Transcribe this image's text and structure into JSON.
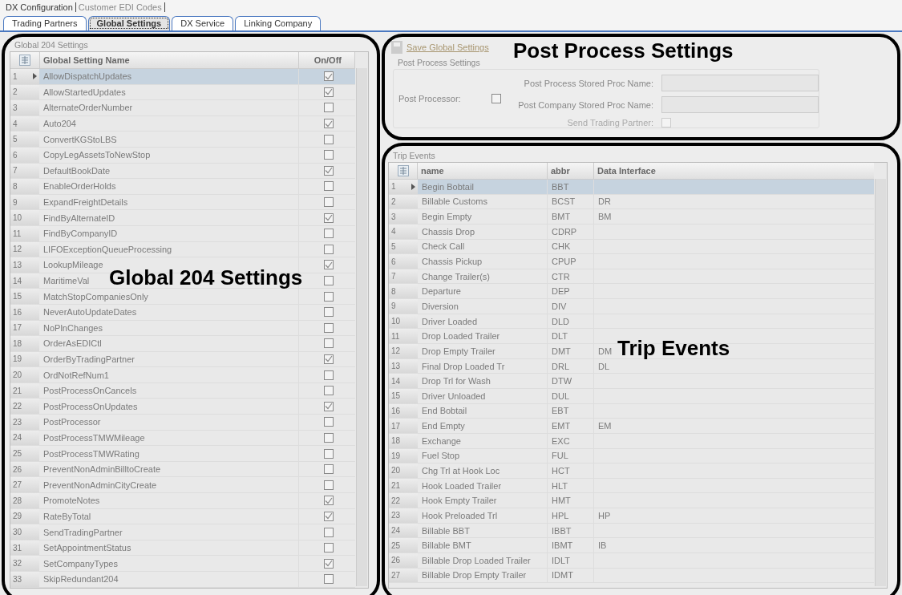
{
  "top_menu": [
    {
      "label": "DX Configuration",
      "selected": true
    },
    {
      "label": "Customer EDI Codes",
      "selected": false
    }
  ],
  "tabs": [
    {
      "label": "Trading Partners",
      "selected": false
    },
    {
      "label": "Global Settings",
      "selected": true
    },
    {
      "label": "DX Service",
      "selected": false
    },
    {
      "label": "Linking Company",
      "selected": false
    }
  ],
  "global_settings": {
    "group_title": "Global 204 Settings",
    "columns": [
      "Global Setting Name",
      "On/Off"
    ],
    "rows": [
      {
        "num": "1",
        "name": "AllowDispatchUpdates",
        "checked": true,
        "selected": true
      },
      {
        "num": "2",
        "name": "AllowStartedUpdates",
        "checked": true,
        "selected": false
      },
      {
        "num": "3",
        "name": "AlternateOrderNumber",
        "checked": false,
        "selected": false
      },
      {
        "num": "4",
        "name": "Auto204",
        "checked": true,
        "selected": false
      },
      {
        "num": "5",
        "name": "ConvertKGStoLBS",
        "checked": false,
        "selected": false
      },
      {
        "num": "6",
        "name": "CopyLegAssetsToNewStop",
        "checked": false,
        "selected": false
      },
      {
        "num": "7",
        "name": "DefaultBookDate",
        "checked": true,
        "selected": false
      },
      {
        "num": "8",
        "name": "EnableOrderHolds",
        "checked": false,
        "selected": false
      },
      {
        "num": "9",
        "name": "ExpandFreightDetails",
        "checked": false,
        "selected": false
      },
      {
        "num": "10",
        "name": "FindByAlternateID",
        "checked": true,
        "selected": false
      },
      {
        "num": "11",
        "name": "FindByCompanyID",
        "checked": false,
        "selected": false
      },
      {
        "num": "12",
        "name": "LIFOExceptionQueueProcessing",
        "checked": false,
        "selected": false
      },
      {
        "num": "13",
        "name": "LookupMileage",
        "checked": true,
        "selected": false
      },
      {
        "num": "14",
        "name": "MaritimeVal",
        "checked": false,
        "selected": false
      },
      {
        "num": "15",
        "name": "MatchStopCompaniesOnly",
        "checked": false,
        "selected": false
      },
      {
        "num": "16",
        "name": "NeverAutoUpdateDates",
        "checked": false,
        "selected": false
      },
      {
        "num": "17",
        "name": "NoPlnChanges",
        "checked": false,
        "selected": false
      },
      {
        "num": "18",
        "name": "OrderAsEDICtl",
        "checked": false,
        "selected": false
      },
      {
        "num": "19",
        "name": "OrderByTradingPartner",
        "checked": true,
        "selected": false
      },
      {
        "num": "20",
        "name": "OrdNotRefNum1",
        "checked": false,
        "selected": false
      },
      {
        "num": "21",
        "name": "PostProcessOnCancels",
        "checked": false,
        "selected": false
      },
      {
        "num": "22",
        "name": "PostProcessOnUpdates",
        "checked": true,
        "selected": false
      },
      {
        "num": "23",
        "name": "PostProcessor",
        "checked": false,
        "selected": false
      },
      {
        "num": "24",
        "name": "PostProcessTMWMileage",
        "checked": false,
        "selected": false
      },
      {
        "num": "25",
        "name": "PostProcessTMWRating",
        "checked": false,
        "selected": false
      },
      {
        "num": "26",
        "name": "PreventNonAdminBilltoCreate",
        "checked": false,
        "selected": false
      },
      {
        "num": "27",
        "name": "PreventNonAdminCityCreate",
        "checked": false,
        "selected": false
      },
      {
        "num": "28",
        "name": "PromoteNotes",
        "checked": true,
        "selected": false
      },
      {
        "num": "29",
        "name": "RateByTotal",
        "checked": true,
        "selected": false
      },
      {
        "num": "30",
        "name": "SendTradingPartner",
        "checked": false,
        "selected": false
      },
      {
        "num": "31",
        "name": "SetAppointmentStatus",
        "checked": false,
        "selected": false
      },
      {
        "num": "32",
        "name": "SetCompanyTypes",
        "checked": true,
        "selected": false
      },
      {
        "num": "33",
        "name": "SkipRedundant204",
        "checked": false,
        "selected": false
      }
    ]
  },
  "save_link": "Save Global Settings",
  "post_process": {
    "group_title": "Post Process Settings",
    "post_processor_label": "Post Processor:",
    "post_processor_checked": false,
    "stored_proc_label": "Post Process Stored Proc Name:",
    "company_proc_label": "Post Company Stored Proc Name:",
    "send_trading_partner_label": "Send Trading Partner:",
    "send_trading_partner_checked": false
  },
  "trip_events": {
    "group_title": "Trip Events",
    "columns": [
      "name",
      "abbr",
      "Data Interface"
    ],
    "rows": [
      {
        "num": "1",
        "name": "Begin Bobtail",
        "abbr": "BBT",
        "selected": true
      },
      {
        "num": "2",
        "name": "Billable Customs",
        "abbr": "BCST",
        "data_interface": "DR",
        "selected": false
      },
      {
        "num": "3",
        "name": "Begin Empty",
        "abbr": "BMT",
        "data_interface": "BM",
        "selected": false
      },
      {
        "num": "4",
        "name": "Chassis Drop",
        "abbr": "CDRP",
        "selected": false
      },
      {
        "num": "5",
        "name": "Check Call",
        "abbr": "CHK",
        "selected": false
      },
      {
        "num": "6",
        "name": "Chassis Pickup",
        "abbr": "CPUP",
        "selected": false
      },
      {
        "num": "7",
        "name": "Change Trailer(s)",
        "abbr": "CTR",
        "selected": false
      },
      {
        "num": "8",
        "name": "Departure",
        "abbr": "DEP",
        "selected": false
      },
      {
        "num": "9",
        "name": "Diversion",
        "abbr": "DIV",
        "selected": false
      },
      {
        "num": "10",
        "name": "Driver Loaded",
        "abbr": "DLD",
        "selected": false
      },
      {
        "num": "11",
        "name": "Drop Loaded Trailer",
        "abbr": "DLT",
        "selected": false
      },
      {
        "num": "12",
        "name": "Drop Empty Trailer",
        "abbr": "DMT",
        "data_interface": "DM",
        "selected": false
      },
      {
        "num": "13",
        "name": "Final Drop Loaded Tr",
        "abbr": "DRL",
        "data_interface": "DL",
        "selected": false
      },
      {
        "num": "14",
        "name": "Drop Trl for Wash",
        "abbr": "DTW",
        "selected": false
      },
      {
        "num": "15",
        "name": "Driver Unloaded",
        "abbr": "DUL",
        "selected": false
      },
      {
        "num": "16",
        "name": "End Bobtail",
        "abbr": "EBT",
        "selected": false
      },
      {
        "num": "17",
        "name": "End Empty",
        "abbr": "EMT",
        "data_interface": "EM",
        "selected": false
      },
      {
        "num": "18",
        "name": "Exchange",
        "abbr": "EXC",
        "selected": false
      },
      {
        "num": "19",
        "name": "Fuel Stop",
        "abbr": "FUL",
        "selected": false
      },
      {
        "num": "20",
        "name": "Chg Trl at Hook Loc",
        "abbr": "HCT",
        "selected": false
      },
      {
        "num": "21",
        "name": "Hook Loaded Trailer",
        "abbr": "HLT",
        "selected": false
      },
      {
        "num": "22",
        "name": "Hook Empty Trailer",
        "abbr": "HMT",
        "selected": false
      },
      {
        "num": "23",
        "name": "Hook Preloaded Trl",
        "abbr": "HPL",
        "data_interface": "HP",
        "selected": false
      },
      {
        "num": "24",
        "name": "Billable BBT",
        "abbr": "IBBT",
        "selected": false
      },
      {
        "num": "25",
        "name": "Billable BMT",
        "abbr": "IBMT",
        "data_interface": "IB",
        "selected": false
      },
      {
        "num": "26",
        "name": "Billable Drop Loaded Trailer",
        "abbr": "IDLT",
        "selected": false
      },
      {
        "num": "27",
        "name": "Billable Drop Empty Trailer",
        "abbr": "IDMT",
        "selected": false
      }
    ]
  },
  "annotations": [
    {
      "label": "Global 204 Settings"
    },
    {
      "label": "Post Process Settings"
    },
    {
      "label": "Trip Events"
    }
  ]
}
